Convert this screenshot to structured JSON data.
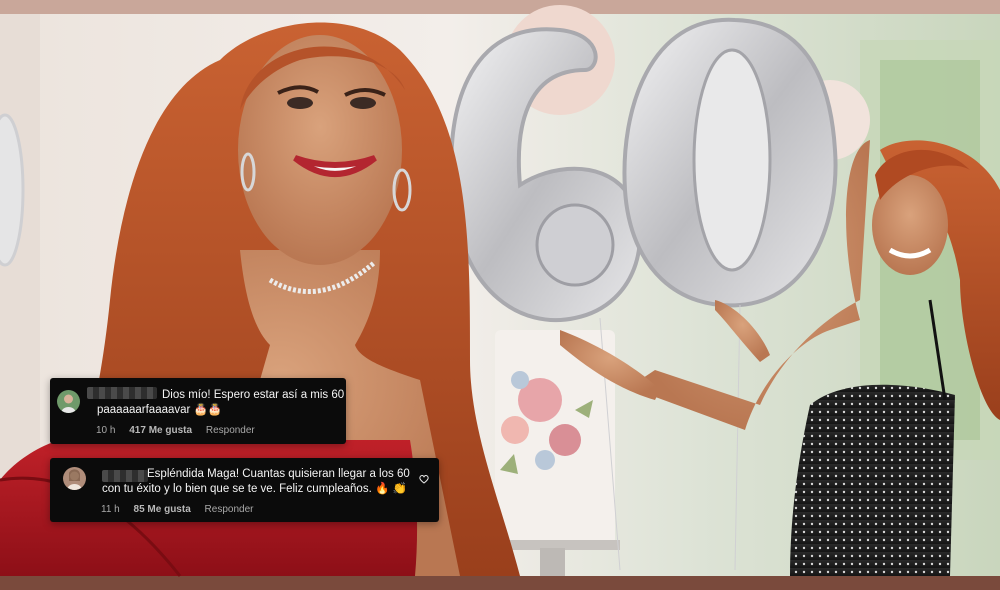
{
  "comments": [
    {
      "avatar": "avatar-icon",
      "line1": "Dios mío! Espero estar así a mis 60",
      "line2": "paaaaaarfaaaavar 🎂🎂",
      "time": "10 h",
      "likes": "417 Me gusta",
      "reply": "Responder"
    },
    {
      "avatar": "avatar-icon",
      "line1": "Espléndida Maga! Cuantas quisieran llegar a los 60",
      "line2": "con tu éxito y lo bien que se te ve. Feliz cumpleaños. 🔥 👏",
      "time": "11 h",
      "likes": "85 Me gusta",
      "reply": "Responder",
      "like_icon": "heart-icon"
    }
  ],
  "photo": {
    "balloon_number": "60"
  },
  "colors": {
    "dress_red": "#b3161f",
    "hair": "#b8542a",
    "balloon_silver": "#d4d4d6",
    "comment_bg": "#0b0b0b"
  }
}
